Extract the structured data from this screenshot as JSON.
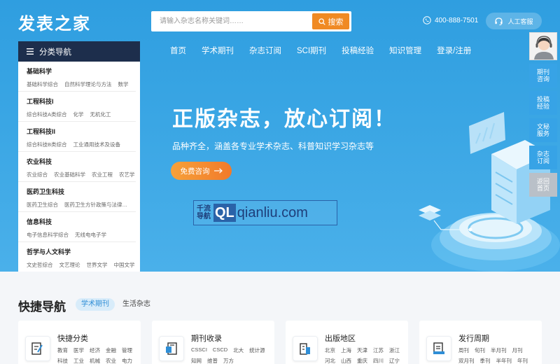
{
  "header": {
    "logo": "发表之家",
    "search_placeholder": "请输入杂志名称关键词……",
    "search_button": "搜索",
    "phone": "400-888-7501",
    "service": "人工客服"
  },
  "nav": [
    "首页",
    "学术期刊",
    "杂志订阅",
    "SCI期刊",
    "投稿经验",
    "知识管理",
    "登录/注册"
  ],
  "category": {
    "header": "分类导航",
    "groups": [
      {
        "title": "基础科学",
        "subs": [
          "基础科学综合",
          "自然科学理论与方法",
          "数学"
        ]
      },
      {
        "title": "工程科技I",
        "subs": [
          "综合科技A类综合",
          "化学",
          "无机化工"
        ]
      },
      {
        "title": "工程科技II",
        "subs": [
          "综合科技B类综合",
          "工业通用技术及设备"
        ]
      },
      {
        "title": "农业科技",
        "subs": [
          "农业综合",
          "农业基础科学",
          "农业工程",
          "农艺学"
        ]
      },
      {
        "title": "医药卫生科技",
        "subs": [
          "医药卫生综合",
          "医药卫生方针政策与法律…"
        ]
      },
      {
        "title": "信息科技",
        "subs": [
          "电子信息科学综合",
          "无线电电子学"
        ]
      },
      {
        "title": "哲学与人文科学",
        "subs": [
          "文史哲综合",
          "文艺理论",
          "世界文学",
          "中国文学"
        ]
      }
    ]
  },
  "hero": {
    "title": "正版杂志，放心订阅！",
    "subtitle": "品种齐全，涵盖各专业学术杂志、科普知识学习杂志等",
    "cta": "免费咨询"
  },
  "watermark": {
    "cn_top": "千流",
    "cn_bottom": "导航",
    "badge": "QL",
    "domain": "qianliu.com"
  },
  "float_panel": [
    "期刊咨询",
    "投稿经验",
    "文秘服务",
    "杂志订阅",
    "返回首页"
  ],
  "quick_nav": {
    "title": "快捷导航",
    "tabs": [
      "学术期刊",
      "生活杂志"
    ],
    "cards": [
      {
        "title": "快捷分类",
        "icon": "edit-document-icon",
        "links": [
          "教育",
          "医学",
          "经济",
          "金融",
          "管理",
          "科技",
          "工业",
          "机械",
          "农业",
          "电力"
        ]
      },
      {
        "title": "期刊收录",
        "icon": "collection-icon",
        "links": [
          "CSSCI",
          "CSCD",
          "北大",
          "统计源",
          "知网",
          "维普",
          "万方"
        ]
      },
      {
        "title": "出版地区",
        "icon": "building-icon",
        "links": [
          "北京",
          "上海",
          "天津",
          "江苏",
          "浙江",
          "河北",
          "山西",
          "重庆",
          "四川",
          "辽宁"
        ]
      },
      {
        "title": "发行周期",
        "icon": "calendar-doc-icon",
        "links": [
          "周刊",
          "旬刊",
          "半月刊",
          "月刊",
          "双月刊",
          "季刊",
          "半年刊",
          "年刊"
        ]
      }
    ]
  },
  "colors": {
    "hero_blue": "#3aa6e4",
    "accent_orange": "#f08a24",
    "sidebar_dark": "#1d2e4c",
    "float_blue": "#37a3e6"
  }
}
